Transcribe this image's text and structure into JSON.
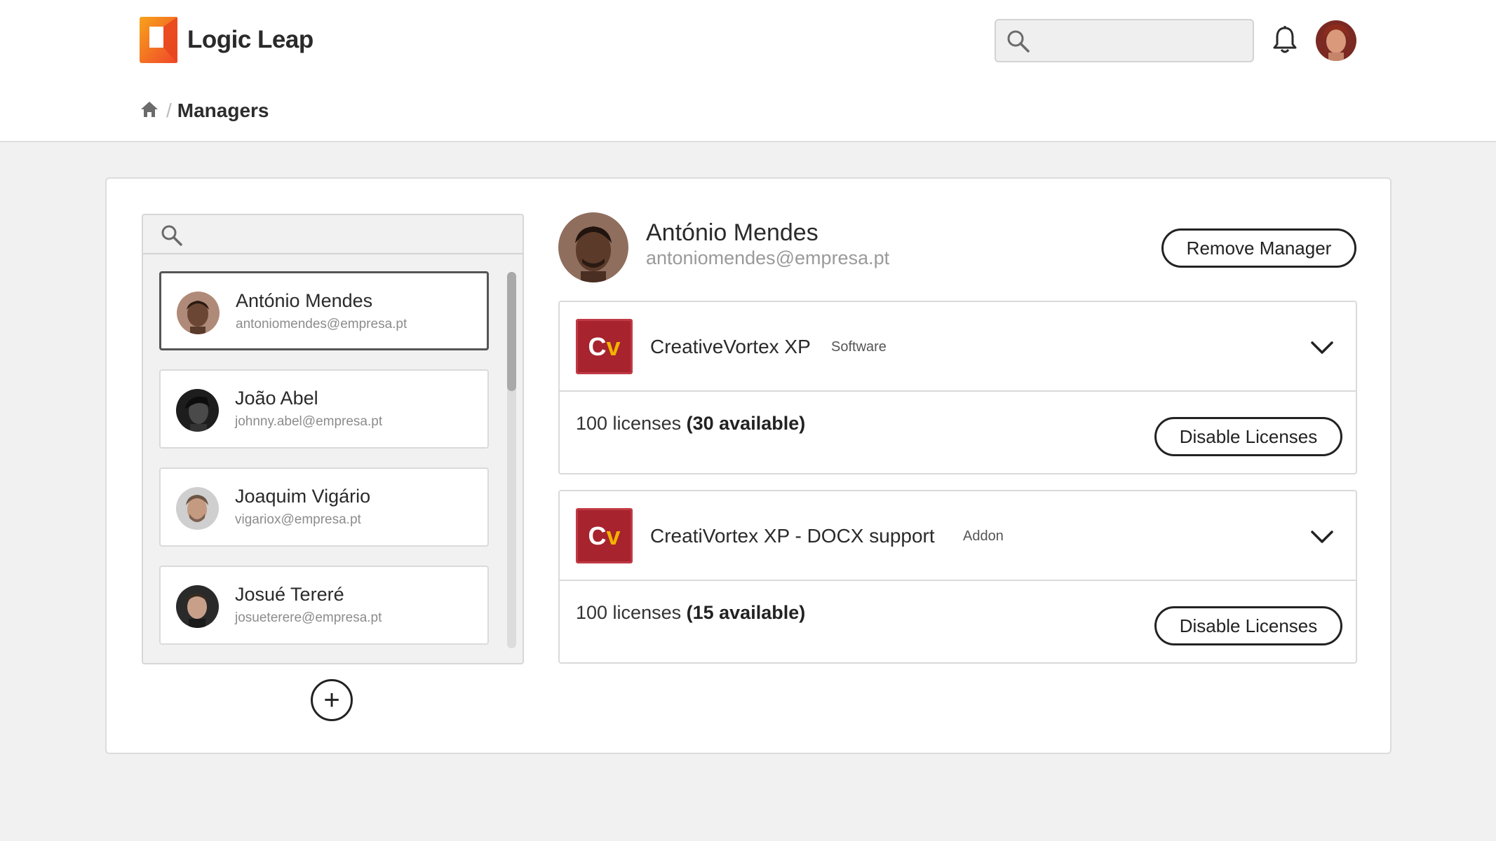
{
  "app": {
    "name": "Logic Leap"
  },
  "header": {
    "search_placeholder": "",
    "notifications_icon": "bell-icon",
    "user_avatar_icon": "avatar"
  },
  "breadcrumb": {
    "home_icon": "home-icon",
    "separator": "/",
    "current": "Managers"
  },
  "managers": {
    "search_placeholder": "",
    "items": [
      {
        "name": "António Mendes",
        "email": "antoniomendes@empresa.pt",
        "selected": true
      },
      {
        "name": "João Abel",
        "email": "johnny.abel@empresa.pt",
        "selected": false
      },
      {
        "name": "Joaquim Vigário",
        "email": "vigariox@empresa.pt",
        "selected": false
      },
      {
        "name": "Josué Tereré",
        "email": "josueterere@empresa.pt",
        "selected": false
      }
    ],
    "add_label": "+"
  },
  "detail": {
    "name": "António Mendes",
    "email": "antoniomendes@empresa.pt",
    "remove_label": "Remove Manager",
    "products": [
      {
        "logo": "Cv",
        "name": "CreativeVortex XP",
        "tag": "Software",
        "licenses_text": "100 licenses",
        "available_text": "(30 available)",
        "disable_label": "Disable Licenses"
      },
      {
        "logo": "Cv",
        "name": "CreatiVortex XP - DOCX support",
        "tag": "Addon",
        "licenses_text": "100 licenses",
        "available_text": "(15 available)",
        "disable_label": "Disable Licenses"
      }
    ]
  },
  "colors": {
    "brand_orange": "#f05a28",
    "brand_yellow": "#f7a21b",
    "product_red": "#a7232d",
    "product_yellow": "#f2b400"
  }
}
